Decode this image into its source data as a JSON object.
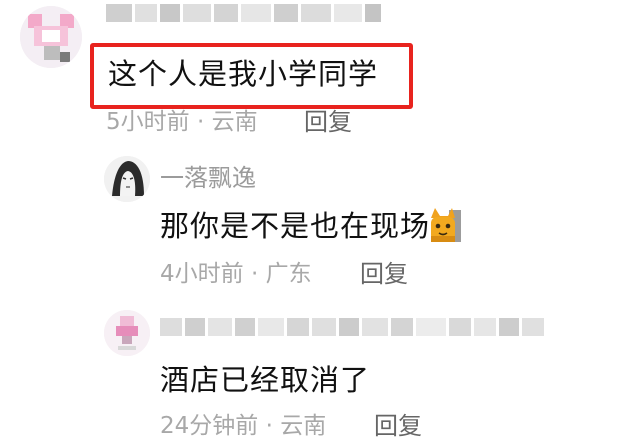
{
  "comments": [
    {
      "username_hidden": true,
      "text": "这个人是我小学同学",
      "meta": "5小时前 · 云南",
      "reply_label": "回复",
      "highlighted": true
    },
    {
      "username": "一落飘逸",
      "text": "那你是不是也在现场",
      "emoji": "cat-emoji",
      "meta": "4小时前 · 广东",
      "reply_label": "回复"
    },
    {
      "username_hidden": true,
      "text": "酒店已经取消了",
      "meta": "24分钟前 · 云南",
      "reply_label": "回复"
    }
  ],
  "colors": {
    "highlight_border": "#e8231e",
    "meta_text": "#a8a8a8",
    "reply_text": "#666666"
  }
}
